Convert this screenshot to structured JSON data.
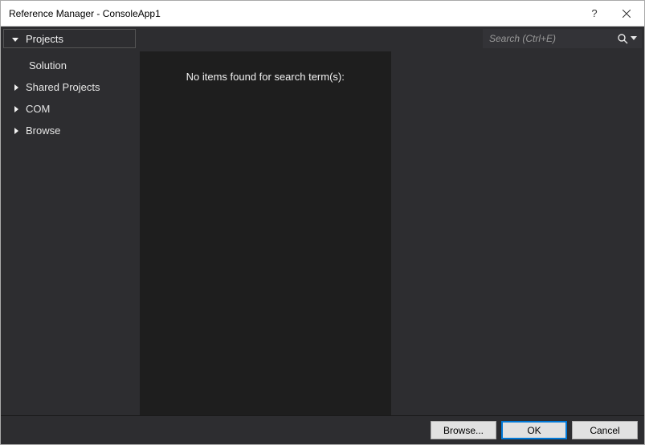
{
  "titlebar": {
    "title": "Reference Manager - ConsoleApp1",
    "help_label": "?",
    "close_label": "Close"
  },
  "sidebar": {
    "activeCategory": "Projects",
    "activeSub": "Solution",
    "items": [
      {
        "label": "Shared Projects"
      },
      {
        "label": "COM"
      },
      {
        "label": "Browse"
      }
    ]
  },
  "search": {
    "placeholder": "Search (Ctrl+E)",
    "value": ""
  },
  "content": {
    "empty_message": "No items found for search term(s):"
  },
  "footer": {
    "browse_label": "Browse...",
    "ok_label": "OK",
    "cancel_label": "Cancel"
  }
}
